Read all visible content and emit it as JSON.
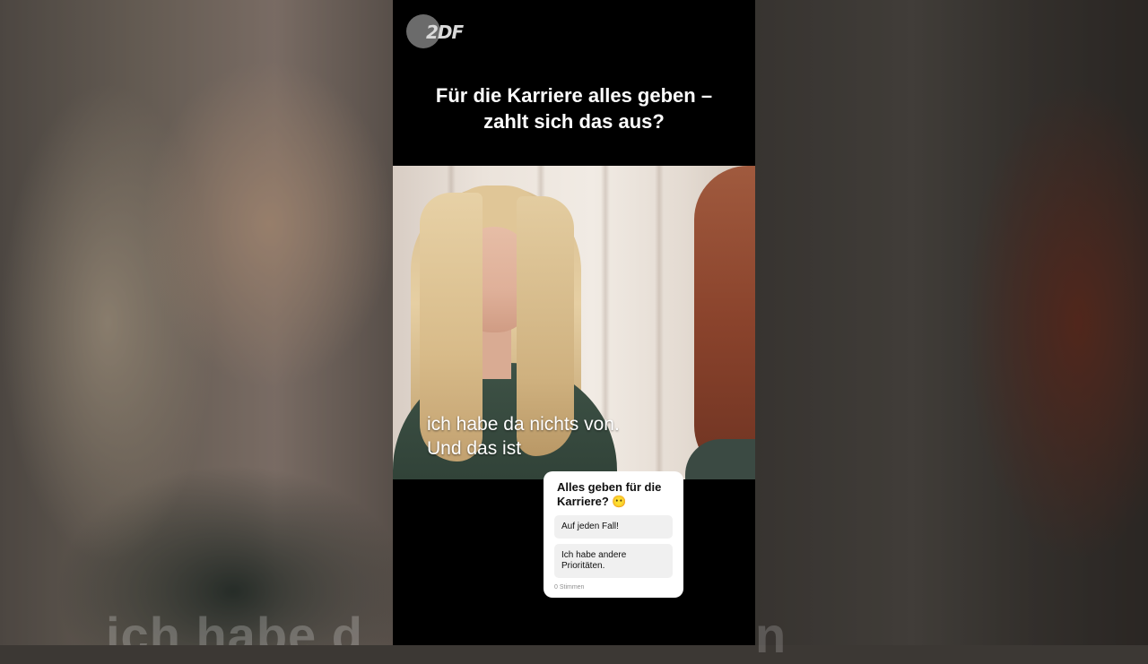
{
  "channel": {
    "logo_text": "2DF"
  },
  "video": {
    "headline_line1": "Für die Karriere alles geben –",
    "headline_line2": "zahlt sich das aus?",
    "subtitle_line1": "ich habe da nichts von.",
    "subtitle_line2": "Und das ist"
  },
  "background": {
    "ghost_subtitle_left": "ich habe d",
    "ghost_subtitle_right": "n"
  },
  "poll": {
    "question": "Alles geben für die Karriere? 😶",
    "options": [
      {
        "label": "Auf jeden Fall!"
      },
      {
        "label": "Ich habe andere Prioritäten."
      }
    ],
    "votes_label": "0 Stimmen"
  },
  "colors": {
    "page_bg": "#3c3834",
    "video_bg": "#000000",
    "poll_bg": "#ffffff",
    "option_bg": "#f0f0f0"
  }
}
